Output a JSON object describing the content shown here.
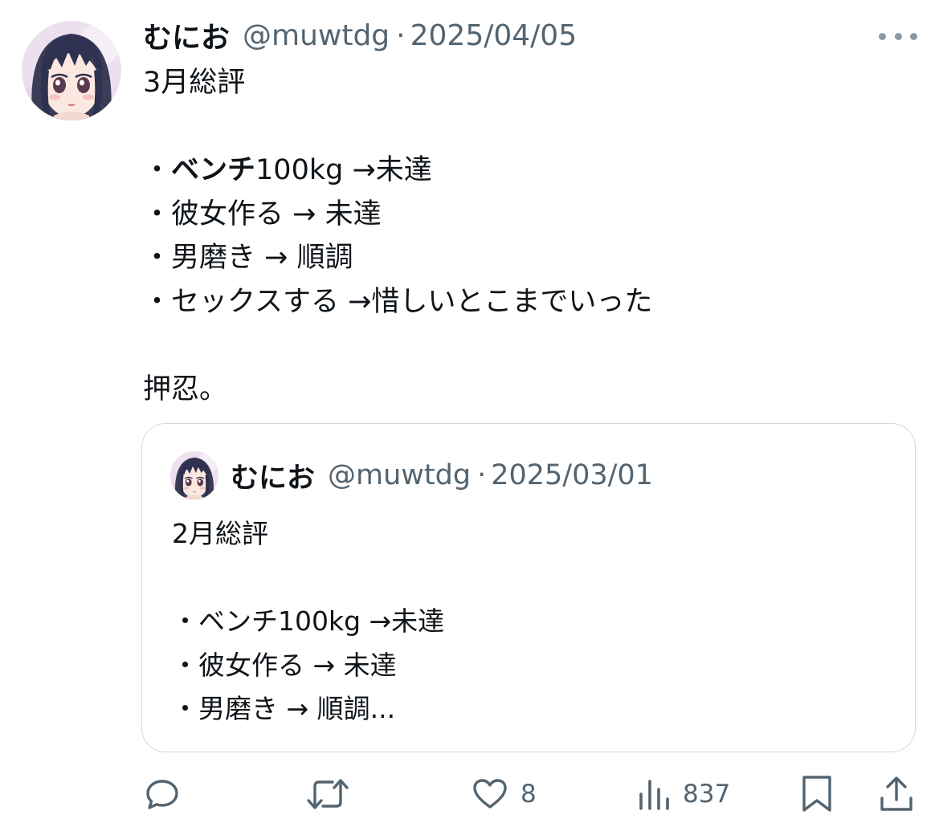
{
  "tweet": {
    "display_name": "むにお",
    "handle": "@muwtdg",
    "separator": "·",
    "date": "2025/04/05",
    "text": {
      "title": "3月総評",
      "items": [
        {
          "bullet": "・",
          "bold": "ベンチ",
          "rest": "100kg →未達"
        },
        {
          "bullet": "・",
          "bold": "",
          "rest": "彼女作る → 未達"
        },
        {
          "bullet": "・",
          "bold": "",
          "rest": "男磨き → 順調"
        },
        {
          "bullet": "・",
          "bold": "",
          "rest": "セックスする →惜しいとこまでいった"
        }
      ],
      "closing": "押忍。"
    }
  },
  "quoted_tweet": {
    "display_name": "むにお",
    "handle": "@muwtdg",
    "separator": "·",
    "date": "2025/03/01",
    "text": {
      "title": "2月総評",
      "items": [
        "・ベンチ100kg →未達",
        "・彼女作る → 未達",
        "・男磨き → 順調..."
      ]
    }
  },
  "actions": {
    "reply": {
      "icon": "reply-icon",
      "count": ""
    },
    "retweet": {
      "icon": "retweet-icon",
      "count": ""
    },
    "like": {
      "icon": "heart-icon",
      "count": "8"
    },
    "views": {
      "icon": "views-icon",
      "count": "837"
    },
    "bookmark": {
      "icon": "bookmark-icon"
    },
    "share": {
      "icon": "share-icon"
    }
  },
  "colors": {
    "text_primary": "#0f1419",
    "text_secondary": "#536471",
    "border": "#cfd9de",
    "more_dots": "#8b98a5",
    "avatar_bg": "#e9dcec",
    "avatar_hair": "#3a3c58"
  }
}
